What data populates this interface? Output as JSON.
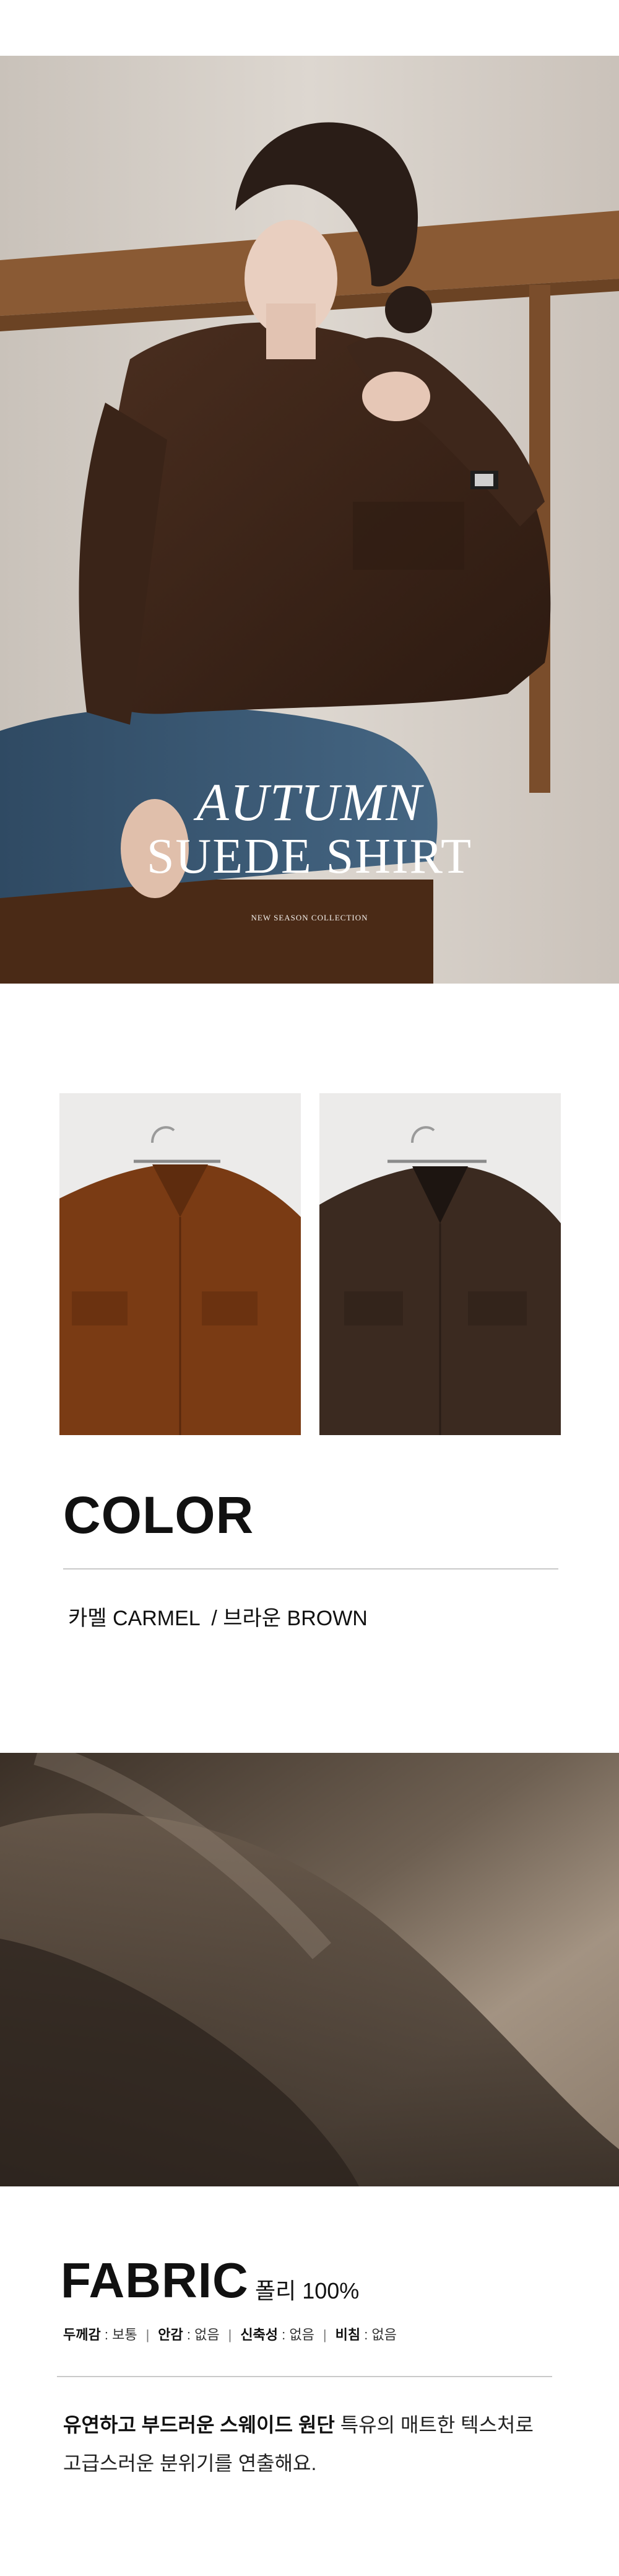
{
  "hero": {
    "title_line1": "AUTUMN",
    "title_line2": "SUEDE SHIRT",
    "caption": "NEW SEASON COLLECTION"
  },
  "color_section": {
    "heading": "COLOR",
    "options_text": "카멜 CARMEL  / 브라운 BROWN",
    "swatches": [
      {
        "name": "CARMEL",
        "color": "#7a3b14"
      },
      {
        "name": "BROWN",
        "color": "#3b2a20"
      }
    ]
  },
  "fabric_section": {
    "heading": "FABRIC",
    "composition": "폴리 100%",
    "specs": [
      {
        "label": "두께감",
        "value": "보통"
      },
      {
        "label": "안감",
        "value": "없음"
      },
      {
        "label": "신축성",
        "value": "없음"
      },
      {
        "label": "비침",
        "value": "없음"
      }
    ],
    "description_bold": "유연하고 부드러운 스웨이드 원단",
    "description_rest": " 특유의 매트한 텍스처로",
    "description_line2": "고급스러운 분위기를 연출해요."
  },
  "colors": {
    "shirt_brown": "#3a2418",
    "fabric_taupe": "#8a7b6c",
    "divider": "#c9c9c9"
  }
}
